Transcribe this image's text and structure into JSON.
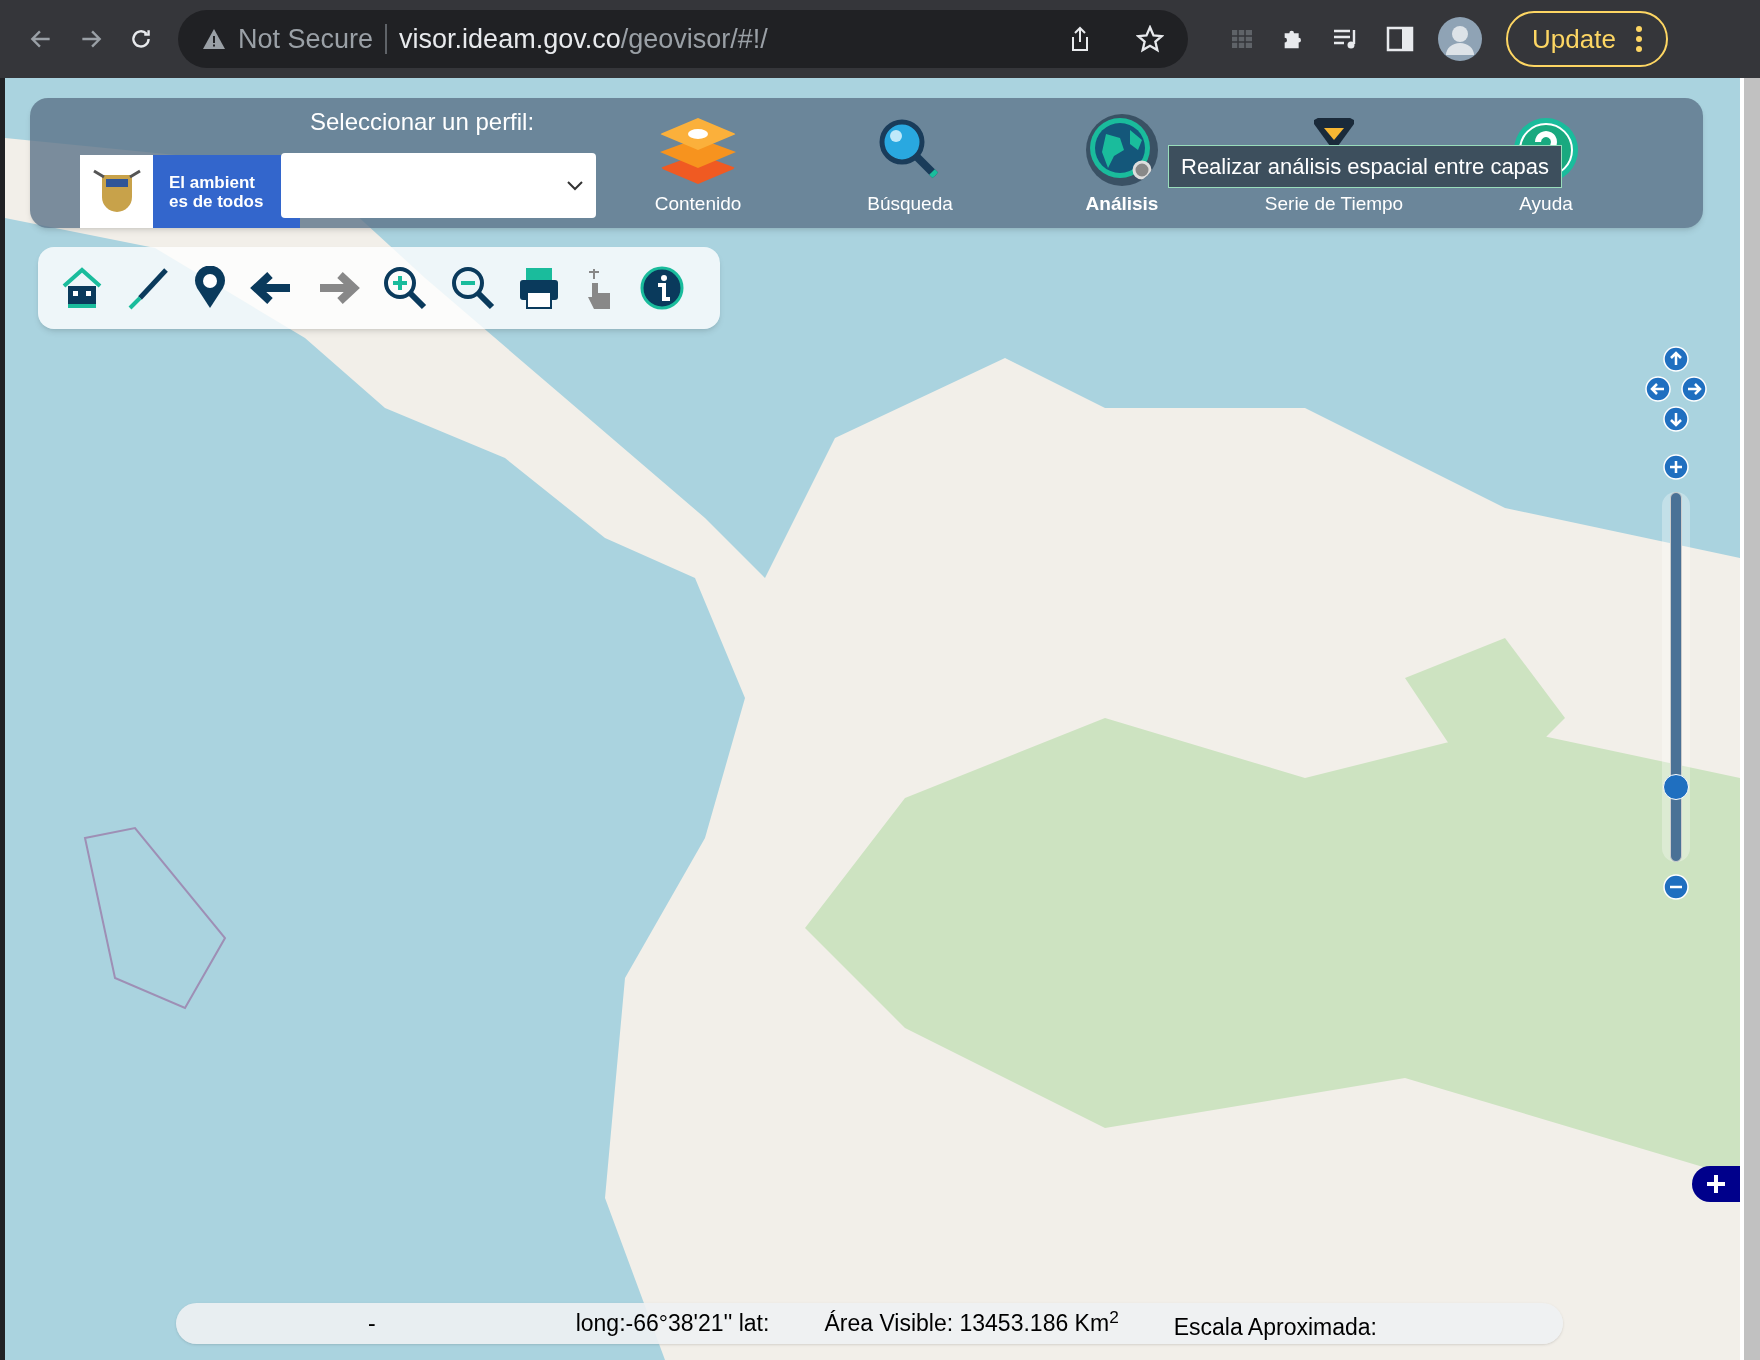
{
  "browser": {
    "security_label": "Not Secure",
    "url_host": "visor.ideam.gov.co",
    "url_path": "/geovisor/#!/",
    "update_button": "Update"
  },
  "header": {
    "logo_lines": [
      "El ambient",
      "es de todos"
    ],
    "profile_label": "Seleccionar un perfil:",
    "menu": [
      {
        "label": "Contenido",
        "kind": "layers",
        "selected": false
      },
      {
        "label": "Búsqueda",
        "kind": "search",
        "selected": false
      },
      {
        "label": "Análisis",
        "kind": "globe",
        "selected": true
      },
      {
        "label": "Serie de Tiempo",
        "kind": "hourglass",
        "selected": false
      },
      {
        "label": "Ayuda",
        "kind": "help",
        "selected": false
      }
    ],
    "tooltip": "Realizar análisis espacial entre capas"
  },
  "toolbar": [
    {
      "kind": "home",
      "disabled": false
    },
    {
      "kind": "pen",
      "disabled": false
    },
    {
      "kind": "pin",
      "disabled": false
    },
    {
      "kind": "back",
      "disabled": false
    },
    {
      "kind": "forward",
      "disabled": true
    },
    {
      "kind": "zoom_in",
      "disabled": false
    },
    {
      "kind": "zoom_out",
      "disabled": false
    },
    {
      "kind": "print",
      "disabled": false
    },
    {
      "kind": "pointer",
      "disabled": true
    },
    {
      "kind": "info",
      "disabled": false
    }
  ],
  "zoom_slider": {
    "level": 0.18
  },
  "status_bar": {
    "field_1": "-",
    "coordinates": "long:-66°38'21'' lat:",
    "visible_area": "Área Visible: 13453.186 Km$^{2}$",
    "scale": "Escala Aproximada:"
  }
}
